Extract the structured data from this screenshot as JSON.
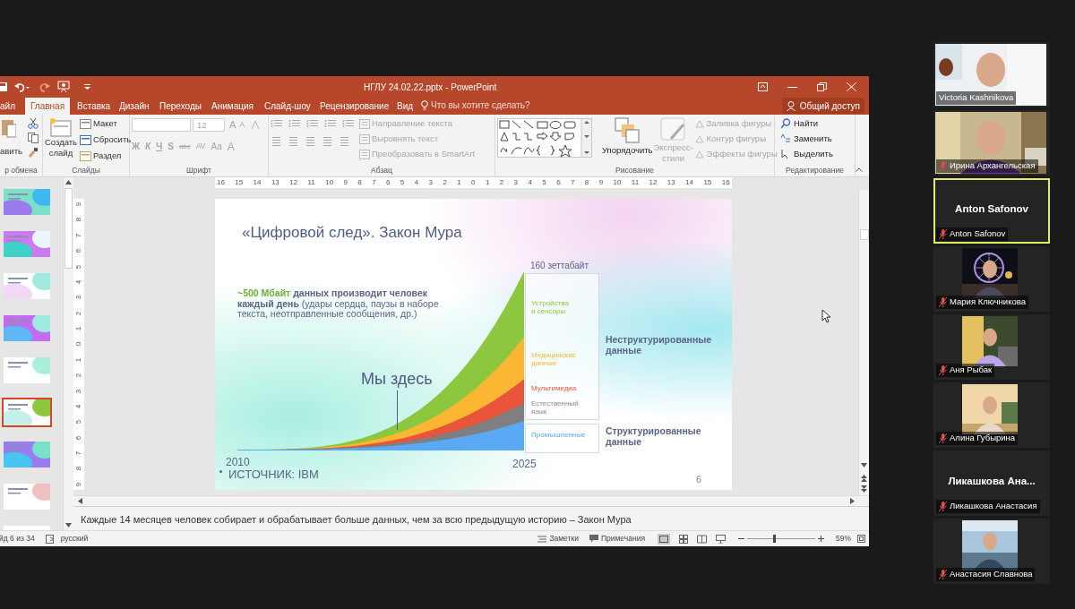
{
  "powerpoint": {
    "title": "НГЛУ 24.02.22.pptx - PowerPoint",
    "tabs": [
      {
        "label": "айл",
        "selected": false
      },
      {
        "label": "Главная",
        "selected": true
      },
      {
        "label": "Вставка",
        "selected": false
      },
      {
        "label": "Дизайн",
        "selected": false
      },
      {
        "label": "Переходы",
        "selected": false
      },
      {
        "label": "Анимация",
        "selected": false
      },
      {
        "label": "Слайд-шоу",
        "selected": false
      },
      {
        "label": "Рецензирование",
        "selected": false
      },
      {
        "label": "Вид",
        "selected": false
      }
    ],
    "tell_me": "Что вы хотите сделать?",
    "share": "Общий доступ",
    "ribbon": {
      "clipboard": {
        "label": "р обмена",
        "paste": "авить"
      },
      "slides": {
        "label": "Слайды",
        "new_slide": "Создать слайд",
        "layout": "Макет",
        "reset": "Сбросить",
        "section": "Раздел"
      },
      "font": {
        "label": "Шрифт",
        "disabled": true,
        "size": "12",
        "grow": "A",
        "shrink": "A",
        "buttons": [
          "Ж",
          "К",
          "Ч",
          "S",
          "abc",
          "AV",
          "Aa",
          "A"
        ]
      },
      "paragraph": {
        "label": "Абзац",
        "disabled": true,
        "commands": [
          "Направление текста",
          "Выровнять текст",
          "Преобразовать в SmartArt"
        ]
      },
      "drawing": {
        "label": "Рисование",
        "arrange": "Упорядочить",
        "quick_styles": "Экспресс-стили",
        "commands": [
          {
            "label": "Заливка фигуры",
            "disabled": true
          },
          {
            "label": "Контур фигуры",
            "disabled": true
          },
          {
            "label": "Эффекты фигуры",
            "disabled": true
          }
        ]
      },
      "editing": {
        "label": "Редактирование",
        "commands": [
          "Найти",
          "Заменить",
          "Выделить"
        ]
      }
    },
    "ruler_h": [
      "16",
      "15",
      "14",
      "13",
      "12",
      "11",
      "10",
      "9",
      "8",
      "7",
      "6",
      "5",
      "4",
      "3",
      "2",
      "1",
      "0",
      "1",
      "2",
      "3",
      "4",
      "5",
      "6",
      "7",
      "8",
      "9",
      "10",
      "11",
      "12",
      "13",
      "14",
      "15",
      "16"
    ],
    "ruler_v": [
      "9",
      "8",
      "7",
      "6",
      "5",
      "4",
      "3",
      "2",
      "1",
      "0",
      "1",
      "2",
      "3",
      "4",
      "5",
      "6",
      "7",
      "8",
      "9"
    ],
    "thumbnails": [
      {
        "selected": false
      },
      {
        "selected": false
      },
      {
        "selected": false
      },
      {
        "selected": false
      },
      {
        "selected": false
      },
      {
        "selected": true
      },
      {
        "selected": false
      },
      {
        "selected": false
      },
      {
        "selected": false
      }
    ],
    "slide": {
      "title": "«Цифровой след». Закон Мура",
      "intro_highlight": "~500 Мбайт",
      "intro": "**данных производит человек каждый день** (удары сердца, паузы в наборе текста, неотправленные сообщения, др.)",
      "total": "160 зеттабайт",
      "marker": "Мы здесь",
      "x_start": "2010",
      "x_end": "2025",
      "source": "ИСТОЧНИК: IBM",
      "number": "6",
      "layers": [
        {
          "label": "Устройства\nи сенсоры",
          "color": "#8dc63f",
          "faded": false
        },
        {
          "label": "Медицинские\nданные",
          "color": "#fbb731",
          "faded": false
        },
        {
          "label": "Мультимедиа",
          "color": "#e8553a",
          "faded": false
        },
        {
          "label": "Естественный\nязык",
          "color": "#7f7f7f",
          "faded": true
        },
        {
          "label": "Промышленные",
          "color": "#5aa9f5",
          "faded": false
        }
      ],
      "groups": [
        "Неструктурированные данные",
        "Структурированные данные"
      ]
    },
    "notes": "Каждые 14 месяцев человек собирает и обрабатывает больше данных, чем за всю предыдущую историю – Закон Мура",
    "status": {
      "slide": "йд 6 из 34",
      "language": "русский",
      "notes": "Заметки",
      "comments": "Примечания",
      "zoom": "59%",
      "zoom_slider": {
        "level": 0.38
      }
    }
  },
  "participants": [
    {
      "name": "Victoria Kashnikova",
      "kind": "video",
      "muted": false,
      "highlighted": false
    },
    {
      "name": "Ирина Архангельская",
      "kind": "video",
      "muted": true,
      "highlighted": false
    },
    {
      "name": "Anton Safonov",
      "kind": "name",
      "display": "Anton Safonov",
      "muted": true,
      "highlighted": true
    },
    {
      "name": "Мария Ключникова",
      "kind": "narrow_video",
      "muted": true,
      "highlighted": false
    },
    {
      "name": "Аня Рыбак",
      "kind": "narrow_video",
      "muted": true,
      "highlighted": false
    },
    {
      "name": "Алина Губырина",
      "kind": "narrow_video",
      "muted": true,
      "highlighted": false
    },
    {
      "name": "Ликашкова Анастасия",
      "kind": "name",
      "display": "Ликашкова  Ана...",
      "muted": true,
      "highlighted": false
    },
    {
      "name": "Анастасия Славнова",
      "kind": "narrow_video",
      "muted": true,
      "highlighted": false
    }
  ]
}
